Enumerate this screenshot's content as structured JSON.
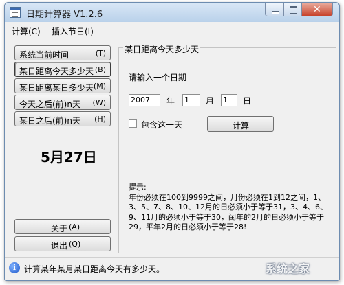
{
  "window": {
    "title": "日期计算器 V1.2.6",
    "icon": "calendar-icon"
  },
  "window_controls": {
    "close_glyph": "✕"
  },
  "menu": [
    {
      "label": "计算(C)"
    },
    {
      "label": "插入节日(I)"
    }
  ],
  "sidebar": {
    "buttons": [
      {
        "label": "系统当前时间",
        "key": "(T)"
      },
      {
        "label": "某日距离今天多少天",
        "key": "(B)"
      },
      {
        "label": "某日距离某日多少天",
        "key": "(M)"
      },
      {
        "label": "今天之后(前)n天",
        "key": "(W)"
      },
      {
        "label": "某日之后(前)n天",
        "key": "(H)"
      }
    ],
    "current_date": "5月27日",
    "about_label": "关于",
    "about_key": "(A)",
    "exit_label": "退出",
    "exit_key": "(Q)"
  },
  "panel": {
    "title": "某日距离今天多少天",
    "prompt": "请输入一个日期",
    "year_value": "2007",
    "year_label": "年",
    "month_value": "1",
    "month_label": "月",
    "day_value": "1",
    "day_label": "日",
    "include_day_label": "包含这一天",
    "include_day_checked": false,
    "calc_label": "计算",
    "hint_title": "提示:",
    "hint_text": "年份必须在100到9999之间，月份必须在1到12之间，1、3、5、7、8、10、12月的日必须小于等于31，3、4、6、9、11月的必须小于等于30，闰年的2月的日必须小于等于29，平年2月的日必须小于等于28!"
  },
  "status": {
    "text": "计算某年某月某日距离今天有多少天。",
    "icon": "info-icon"
  },
  "watermark": "系统之家"
}
